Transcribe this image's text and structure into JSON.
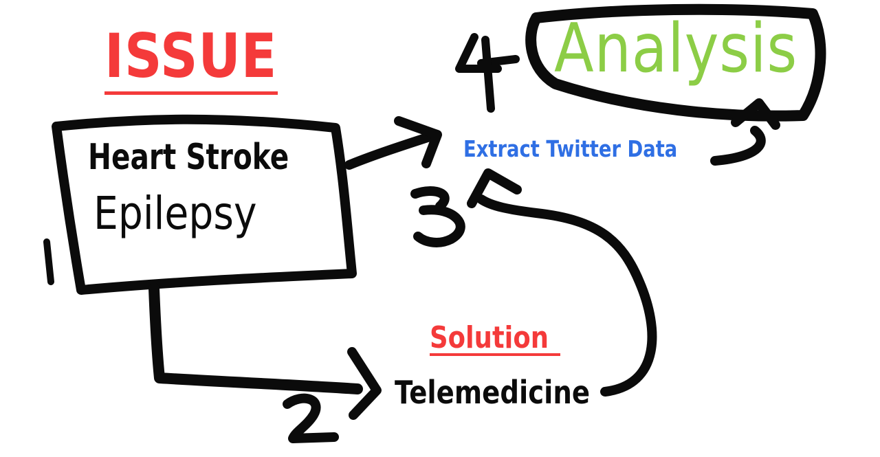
{
  "issue": {
    "title": "ISSUE",
    "items": [
      "Heart Stroke",
      "Epilepsy"
    ]
  },
  "solution": {
    "title": "Solution",
    "items": [
      "Telemedicine"
    ]
  },
  "steps": {
    "extract": "Extract Twitter Data",
    "analysis": "Analysis"
  },
  "colors": {
    "accent_red": "#f43a3a",
    "analysis_green": "#8ccd46",
    "extract_blue": "#2f6fe4",
    "ink": "#0b0b0b"
  }
}
